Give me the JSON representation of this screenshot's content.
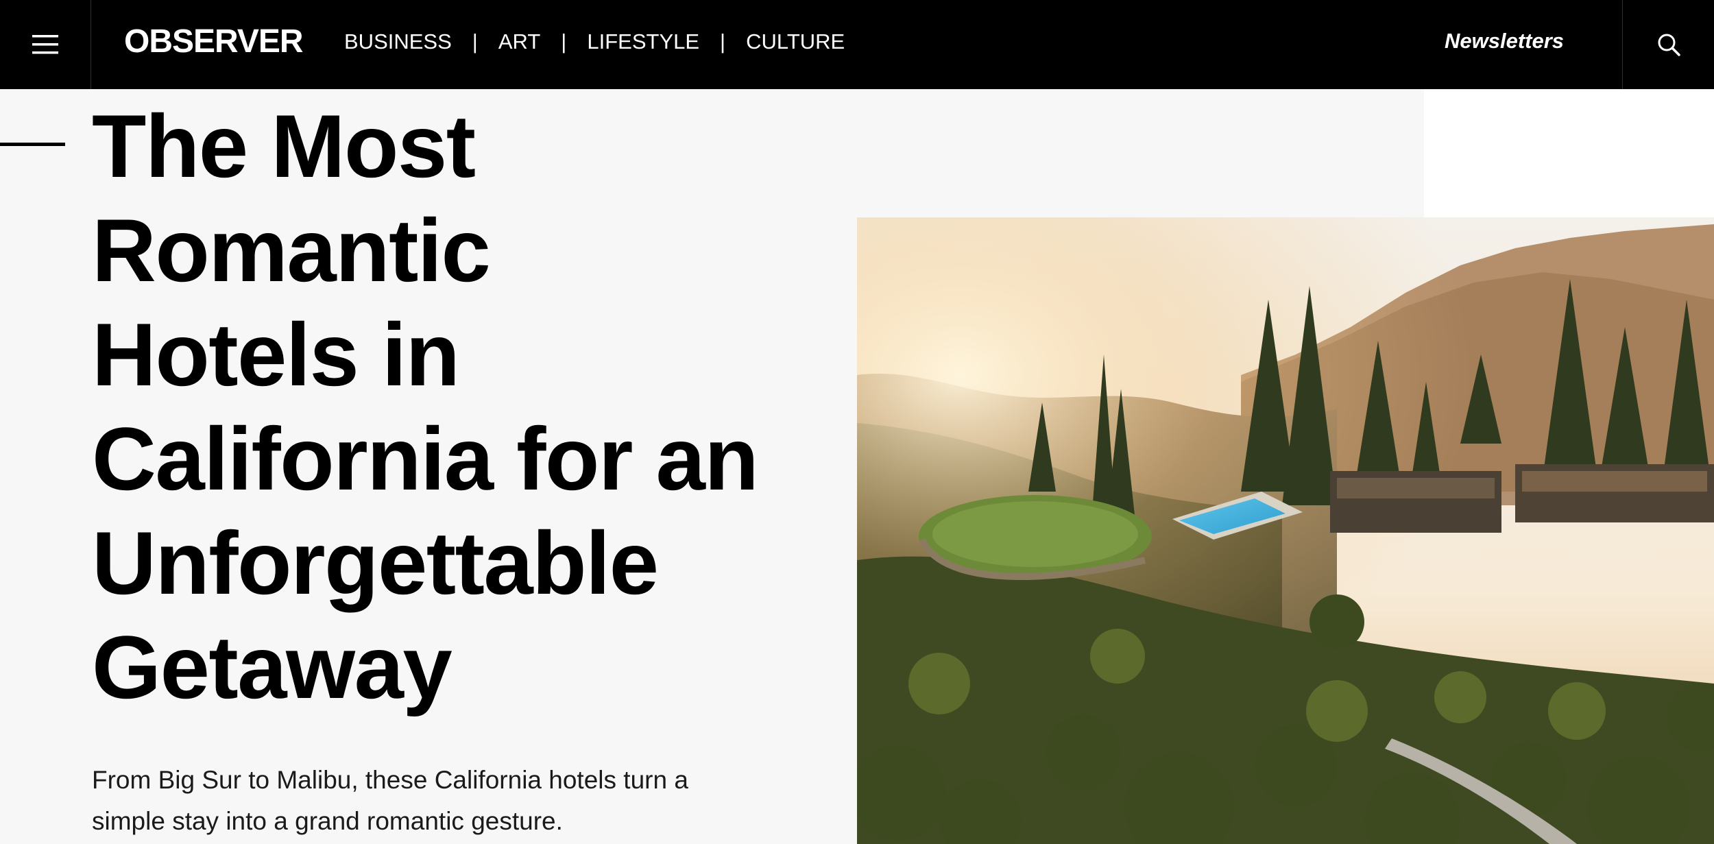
{
  "header": {
    "logo": "OBSERVER",
    "nav": [
      "BUSINESS",
      "ART",
      "LIFESTYLE",
      "CULTURE"
    ],
    "separator": "|",
    "newsletters": "Newsletters",
    "menu_icon": "hamburger-menu-icon",
    "search_icon": "search-icon"
  },
  "article": {
    "headline_lines": [
      "The Most",
      "Romantic",
      "Hotels in",
      "California for an",
      "Unforgettable",
      "Getaway"
    ],
    "dek_lines": [
      "From Big Sur to Malibu, these California hotels turn a",
      "simple stay into a grand romantic gesture."
    ]
  },
  "colors": {
    "header_bg": "#000000",
    "page_bg": "#f7f7f7",
    "text": "#000000"
  }
}
